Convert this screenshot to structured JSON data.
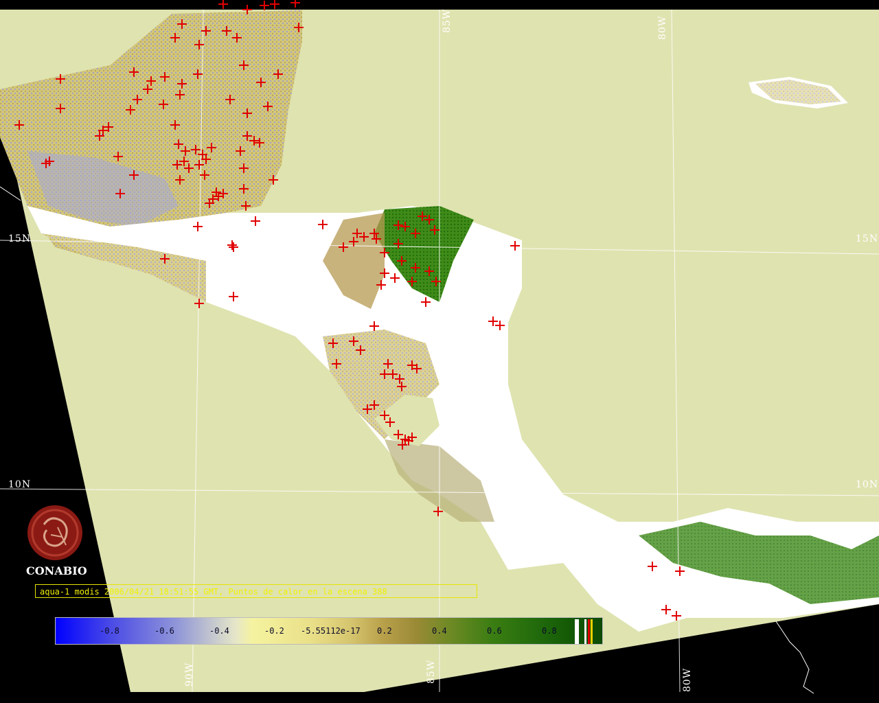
{
  "grid": {
    "lat_labels_left": [
      "15N",
      "10N"
    ],
    "lat_labels_right": [
      "15N",
      "10N"
    ],
    "lon_labels_top": [
      "85W",
      "80W"
    ],
    "lon_labels_bottom": [
      "90W",
      "85W",
      "80W"
    ]
  },
  "logo": {
    "text": "CONABIO",
    "icon": "conabio-seal-logo"
  },
  "caption": "aqua-1 modis 2006/04/21 18:51:55 GMT, Puntos de calor en la escena 388",
  "colorbar": {
    "ticks": [
      "-0.8",
      "-0.6",
      "-0.4",
      "-0.2",
      "-5.55112e-17",
      "0.2",
      "0.4",
      "0.6",
      "0.8"
    ]
  },
  "colors": {
    "background": "#000000",
    "ocean": "#dfe3b0",
    "cloud": "#ffffff",
    "fire_marker": "#e00000",
    "caption": "#f0f000",
    "grid": "#ffffff"
  }
}
